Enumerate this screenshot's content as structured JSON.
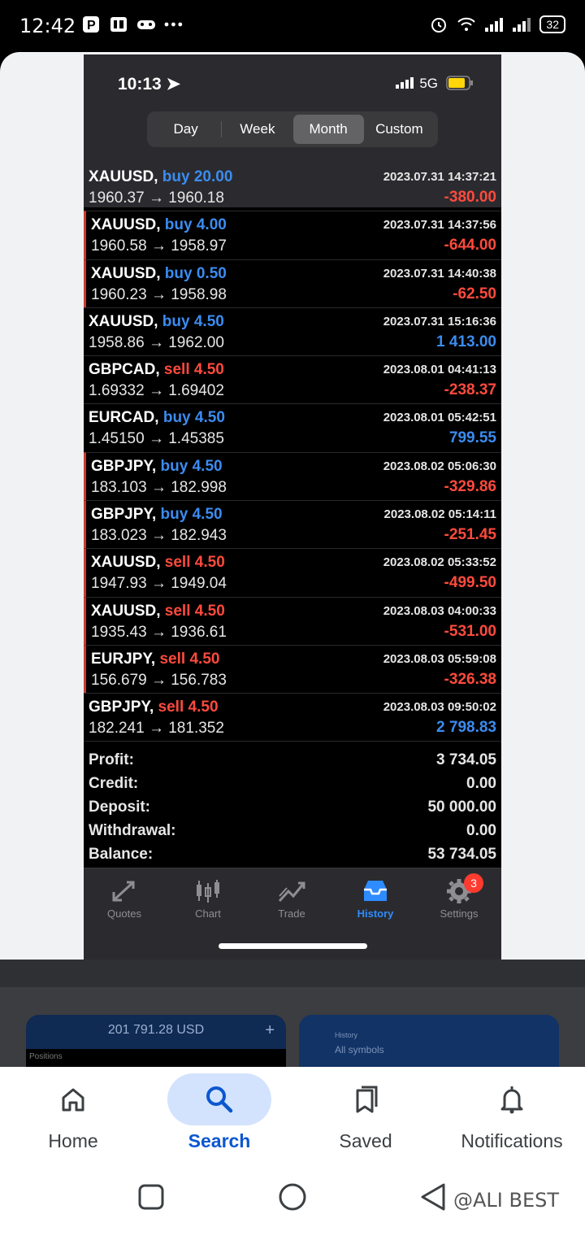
{
  "android_status": {
    "time": "12:42",
    "battery": "32"
  },
  "iphone": {
    "time": "10:13",
    "network": "5G",
    "tabs": [
      "Day",
      "Week",
      "Month",
      "Custom"
    ],
    "active_tab": "Month"
  },
  "trades": [
    {
      "symbol": "XAUUSD,",
      "side": "buy",
      "volume": "20.00",
      "prices": "1960.37 → 1960.18",
      "datetime": "2023.07.31 14:37:21",
      "profit": "-380.00",
      "flag": false
    },
    {
      "symbol": "XAUUSD,",
      "side": "buy",
      "volume": "4.00",
      "prices": "1960.58 → 1958.97",
      "datetime": "2023.07.31 14:37:56",
      "profit": "-644.00",
      "flag": true
    },
    {
      "symbol": "XAUUSD,",
      "side": "buy",
      "volume": "0.50",
      "prices": "1960.23 → 1958.98",
      "datetime": "2023.07.31 14:40:38",
      "profit": "-62.50",
      "flag": true
    },
    {
      "symbol": "XAUUSD,",
      "side": "buy",
      "volume": "4.50",
      "prices": "1958.86 → 1962.00",
      "datetime": "2023.07.31 15:16:36",
      "profit": "1 413.00",
      "flag": false
    },
    {
      "symbol": "GBPCAD,",
      "side": "sell",
      "volume": "4.50",
      "prices": "1.69332 → 1.69402",
      "datetime": "2023.08.01 04:41:13",
      "profit": "-238.37",
      "flag": false
    },
    {
      "symbol": "EURCAD,",
      "side": "buy",
      "volume": "4.50",
      "prices": "1.45150 → 1.45385",
      "datetime": "2023.08.01 05:42:51",
      "profit": "799.55",
      "flag": false
    },
    {
      "symbol": "GBPJPY,",
      "side": "buy",
      "volume": "4.50",
      "prices": "183.103 → 182.998",
      "datetime": "2023.08.02 05:06:30",
      "profit": "-329.86",
      "flag": true
    },
    {
      "symbol": "GBPJPY,",
      "side": "buy",
      "volume": "4.50",
      "prices": "183.023 → 182.943",
      "datetime": "2023.08.02 05:14:11",
      "profit": "-251.45",
      "flag": true
    },
    {
      "symbol": "XAUUSD,",
      "side": "sell",
      "volume": "4.50",
      "prices": "1947.93 → 1949.04",
      "datetime": "2023.08.02 05:33:52",
      "profit": "-499.50",
      "flag": true
    },
    {
      "symbol": "XAUUSD,",
      "side": "sell",
      "volume": "4.50",
      "prices": "1935.43 → 1936.61",
      "datetime": "2023.08.03 04:00:33",
      "profit": "-531.00",
      "flag": true
    },
    {
      "symbol": "EURJPY,",
      "side": "sell",
      "volume": "4.50",
      "prices": "156.679 → 156.783",
      "datetime": "2023.08.03 05:59:08",
      "profit": "-326.38",
      "flag": true
    },
    {
      "symbol": "GBPJPY,",
      "side": "sell",
      "volume": "4.50",
      "prices": "182.241 → 181.352",
      "datetime": "2023.08.03 09:50:02",
      "profit": "2 798.83",
      "flag": false
    }
  ],
  "summary": [
    {
      "label": "Profit:",
      "value": "3 734.05"
    },
    {
      "label": "Credit:",
      "value": "0.00"
    },
    {
      "label": "Deposit:",
      "value": "50 000.00"
    },
    {
      "label": "Withdrawal:",
      "value": "0.00"
    },
    {
      "label": "Balance:",
      "value": "53 734.05"
    }
  ],
  "tabbar": {
    "items": [
      "Quotes",
      "Chart",
      "Trade",
      "History",
      "Settings"
    ],
    "active": "History",
    "settings_badge": "3"
  },
  "cards": {
    "card1_amount": "201 791.28 USD",
    "card1_plus": "+",
    "card1_section": "Positions",
    "card2_title": "History",
    "card2_subtitle": "All symbols"
  },
  "google_nav": {
    "items": [
      "Home",
      "Search",
      "Saved",
      "Notifications"
    ],
    "active": "Search"
  },
  "watermark": "@ALI BEST"
}
